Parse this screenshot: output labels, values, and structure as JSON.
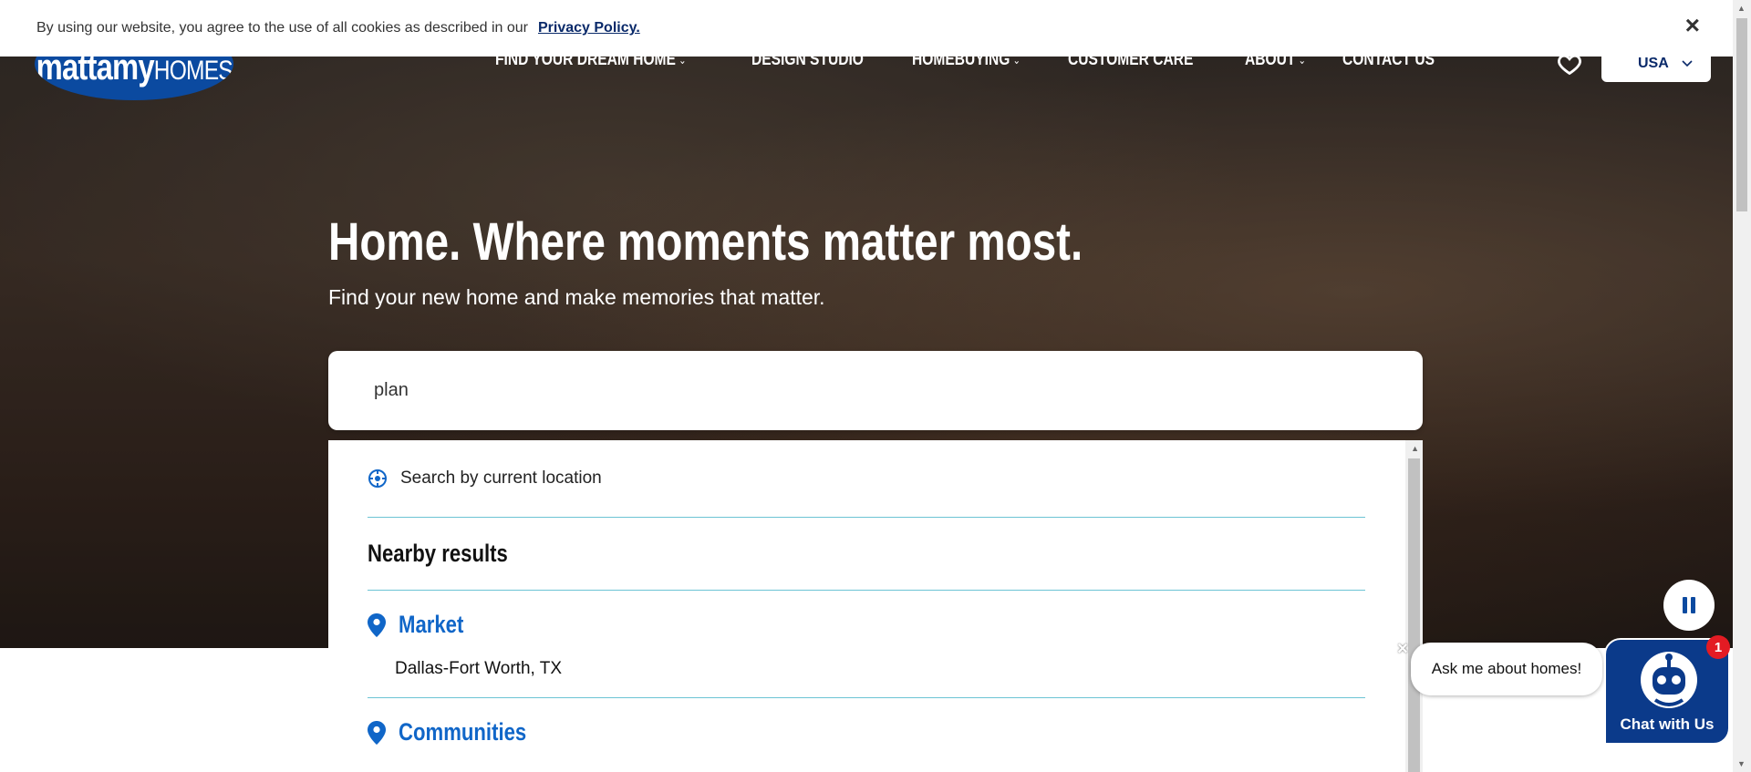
{
  "cookie_bar": {
    "message": "By using our website, you agree to the use of all cookies as described in our",
    "link_text": "Privacy Policy.",
    "close_symbol": "×"
  },
  "header": {
    "logo_main": "mattamy",
    "logo_sub": "HOMES",
    "nav": [
      {
        "label": "FIND YOUR DREAM HOME",
        "has_dropdown": true
      },
      {
        "label": "DESIGN STUDIO",
        "has_dropdown": false
      },
      {
        "label": "HOMEBUYING",
        "has_dropdown": true
      },
      {
        "label": "CUSTOMER CARE",
        "has_dropdown": false
      },
      {
        "label": "ABOUT",
        "has_dropdown": true
      },
      {
        "label": "CONTACT US",
        "has_dropdown": false
      }
    ],
    "country": "USA"
  },
  "hero": {
    "headline": "Home. Where moments matter most.",
    "subhead": "Find your new home and make memories that matter."
  },
  "search": {
    "value": "plan",
    "placeholder": ""
  },
  "dropdown": {
    "current_location_label": "Search by current location",
    "nearby_heading": "Nearby results",
    "sections": [
      {
        "title": "Market",
        "results": [
          "Dallas-Fort Worth, TX"
        ]
      },
      {
        "title": "Communities",
        "results": []
      }
    ]
  },
  "chat": {
    "prompt": "Ask me about homes!",
    "button_label": "Chat with Us",
    "badge_count": "1",
    "close_symbol": "×"
  },
  "colors": {
    "brand_blue": "#0b4aa0",
    "link_blue": "#1066c8",
    "divider_teal": "#6cc4d4",
    "badge_red": "#e31b23"
  }
}
